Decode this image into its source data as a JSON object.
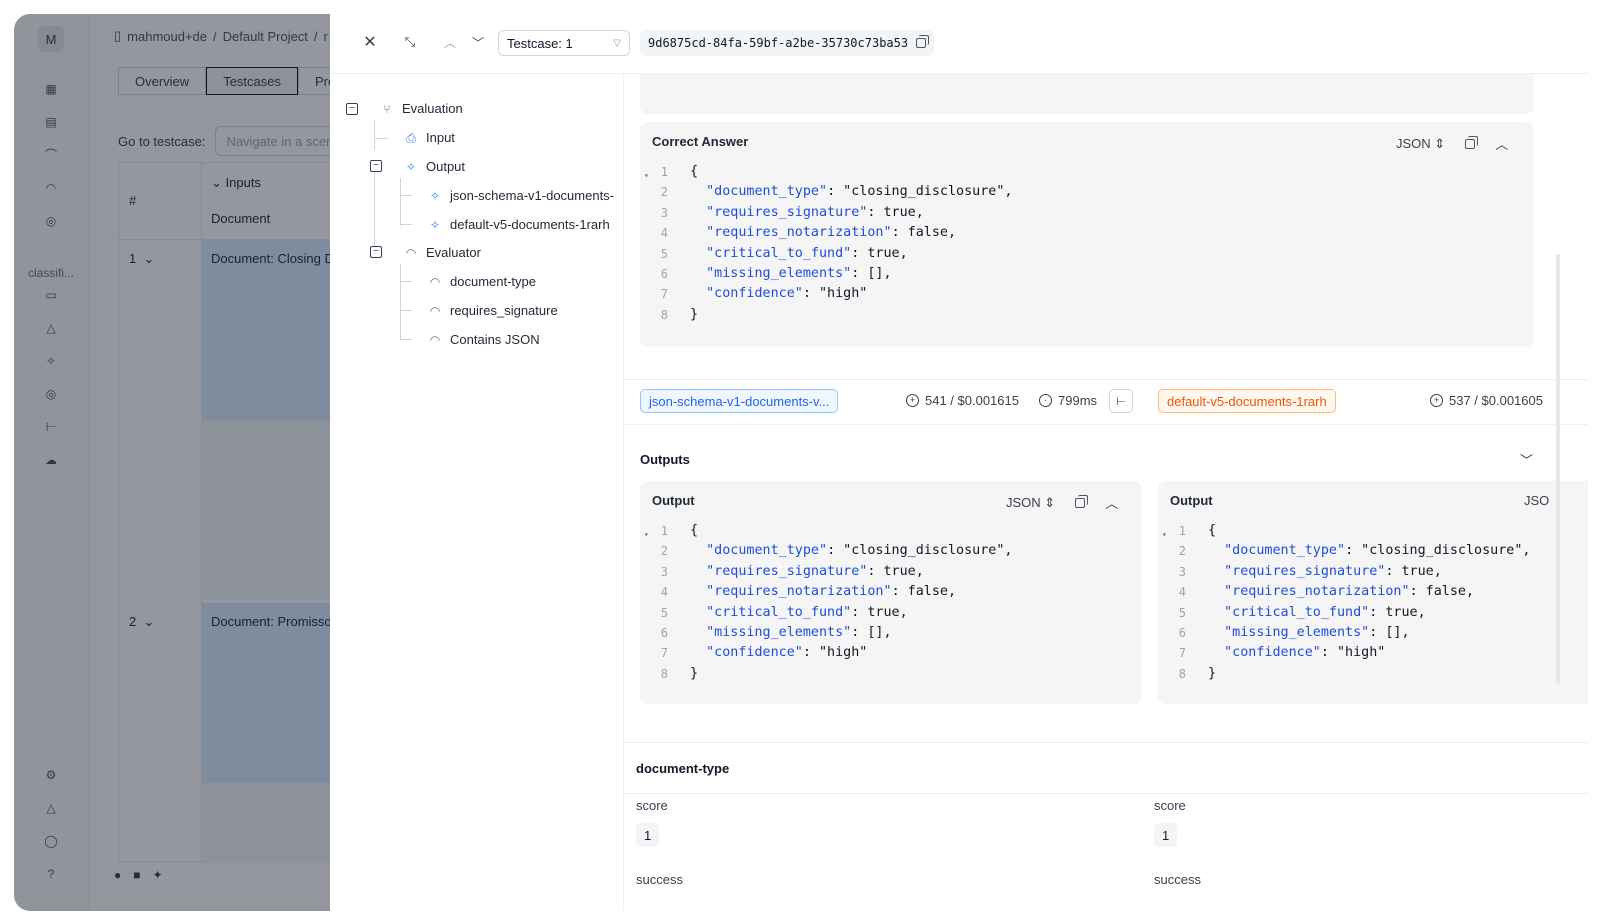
{
  "background": {
    "avatar": "M",
    "breadcrumb": [
      "mahmoud+de",
      "/",
      "Default Project",
      "/",
      "r"
    ],
    "tabs": [
      "Overview",
      "Testcases",
      "Pro"
    ],
    "goto_label": "Go to testcase:",
    "goto_placeholder": "Navigate in a scen",
    "rail_label": "classifi...",
    "table": {
      "hash": "#",
      "inputs": "Inputs",
      "document": "Document",
      "rows": [
        {
          "num": "1",
          "doc": "Document: Closing D"
        },
        {
          "num": "2",
          "doc": "Document: Promisso"
        }
      ]
    }
  },
  "drawer": {
    "testcase_select": "Testcase: 1",
    "uuid": "9d6875cd-84fa-59bf-a2be-35730c73ba53",
    "tree": {
      "evaluation": "Evaluation",
      "input": "Input",
      "output": "Output",
      "output_children": [
        "json-schema-v1-documents-",
        "default-v5-documents-1rarh"
      ],
      "evaluator": "Evaluator",
      "evaluator_children": [
        "document-type",
        "requires_signature",
        "Contains JSON"
      ]
    },
    "correct_answer": {
      "title": "Correct Answer",
      "format": "JSON",
      "lines": [
        "{",
        "  \"document_type\": \"closing_disclosure\",",
        "  \"requires_signature\": true,",
        "  \"requires_notarization\": false,",
        "  \"critical_to_fund\": true,",
        "  \"missing_elements\": [],",
        "  \"confidence\": \"high\"",
        "}"
      ]
    },
    "runs": [
      {
        "name": "json-schema-v1-documents-v...",
        "tokens_cost": "541 / $0.001615",
        "latency": "799ms"
      },
      {
        "name": "default-v5-documents-1rarh",
        "tokens_cost": "537 / $0.001605"
      }
    ],
    "outputs_title": "Outputs",
    "output_cards": [
      {
        "title": "Output",
        "format": "JSON"
      },
      {
        "title": "Output",
        "format": "JSO"
      }
    ],
    "output_lines": [
      "{",
      "  \"document_type\": \"closing_disclosure\",",
      "  \"requires_signature\": true,",
      "  \"requires_notarization\": false,",
      "  \"critical_to_fund\": true,",
      "  \"missing_elements\": [],",
      "  \"confidence\": \"high\"",
      "}"
    ],
    "evaluator_section": {
      "title": "document-type",
      "score_label": "score",
      "score_value": "1",
      "success_label": "success"
    }
  },
  "colors": {
    "accent_blue": "#2563eb",
    "accent_orange": "#ea580c",
    "overlay": "#111827"
  }
}
